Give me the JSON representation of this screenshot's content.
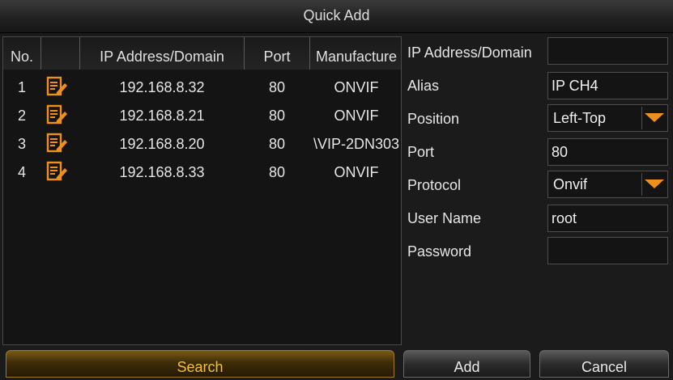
{
  "window": {
    "title": "Quick Add"
  },
  "table": {
    "columns": [
      "No.",
      "",
      "IP Address/Domain",
      "Port",
      "Manufacture"
    ],
    "rows": [
      {
        "no": "1",
        "ip": "192.168.8.32",
        "port": "80",
        "manufacturer": "ONVIF"
      },
      {
        "no": "2",
        "ip": "192.168.8.21",
        "port": "80",
        "manufacturer": "ONVIF"
      },
      {
        "no": "3",
        "ip": "192.168.8.20",
        "port": "80",
        "manufacturer": "\\VIP-2DN303"
      },
      {
        "no": "4",
        "ip": "192.168.8.33",
        "port": "80",
        "manufacturer": "ONVIF"
      }
    ],
    "row_icon": "edit-icon"
  },
  "form": {
    "ip_label": "IP Address/Domain",
    "ip_value": "",
    "alias_label": "Alias",
    "alias_value": "IP CH4",
    "position_label": "Position",
    "position_value": "Left-Top",
    "port_label": "Port",
    "port_value": "80",
    "protocol_label": "Protocol",
    "protocol_value": "Onvif",
    "username_label": "User Name",
    "username_value": "root",
    "password_label": "Password",
    "password_value": ""
  },
  "buttons": {
    "search": "Search",
    "add": "Add",
    "cancel": "Cancel"
  },
  "colors": {
    "accent": "#f0901c",
    "search_text": "#f2c040"
  }
}
